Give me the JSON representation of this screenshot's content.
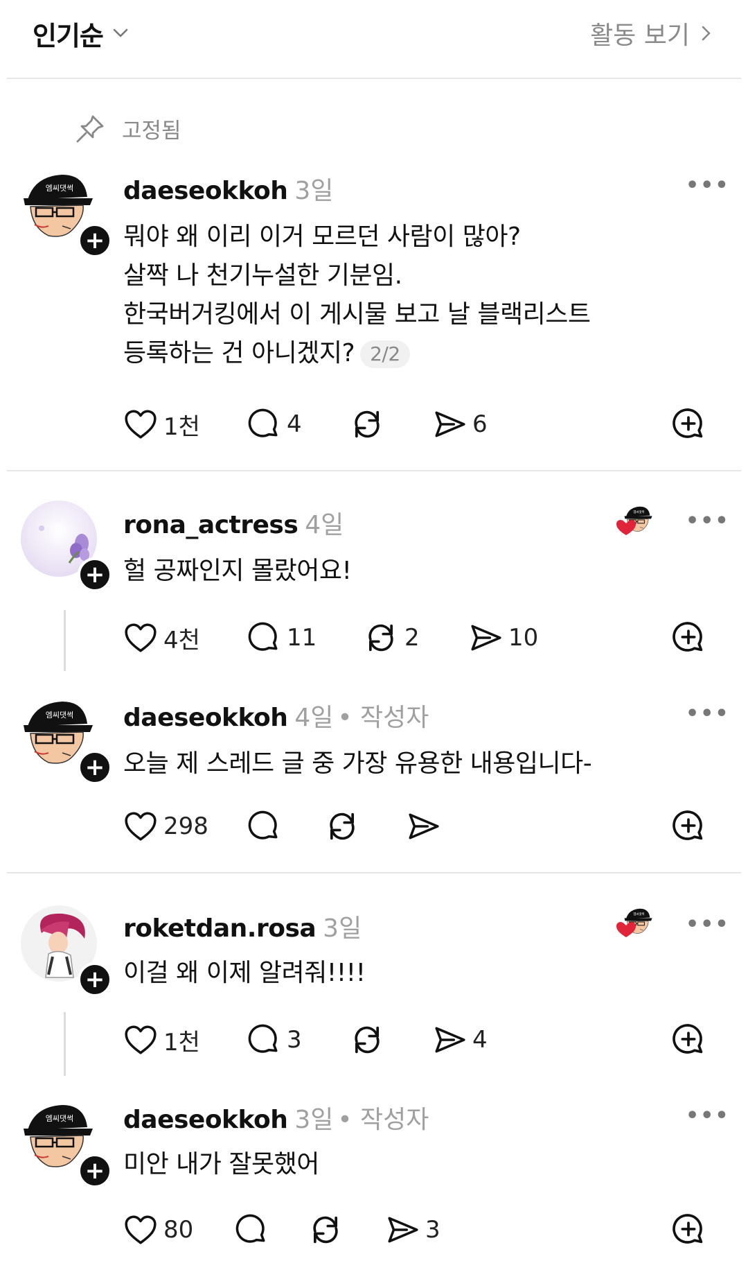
{
  "header": {
    "sort_label": "인기순",
    "activity_label": "활동 보기"
  },
  "pinned_label": "고정됨",
  "author_tag": "• 작성자",
  "comments": [
    {
      "username": "daeseokkoh",
      "time": "3일",
      "lines": [
        "뭐야 왜 이리 이거 모르던 사람이 많아?",
        "살짝 나 천기누설한 기분임.",
        "한국버거킹에서 이 게시물 보고 날 블랙리스트",
        "등록하는 건 아니겠지?"
      ],
      "page_indicator": "2/2",
      "likes": "1천",
      "replies": "4",
      "reposts": "",
      "shares": "6"
    },
    {
      "username": "rona_actress",
      "time": "4일",
      "lines": [
        "헐 공짜인지 몰랐어요!"
      ],
      "likes": "4천",
      "replies": "11",
      "reposts": "2",
      "shares": "10"
    },
    {
      "username": "daeseokkoh",
      "time": "4일",
      "lines": [
        "오늘 제 스레드 글 중 가장 유용한 내용입니다-"
      ],
      "likes": "298",
      "replies": "",
      "reposts": "",
      "shares": ""
    },
    {
      "username": "roketdan.rosa",
      "time": "3일",
      "lines": [
        "이걸 왜 이제 알려줘!!!!"
      ],
      "likes": "1천",
      "replies": "3",
      "reposts": "",
      "shares": "4"
    },
    {
      "username": "daeseokkoh",
      "time": "3일",
      "lines": [
        "미안 내가 잘못했어"
      ],
      "likes": "80",
      "replies": "",
      "reposts": "",
      "shares": "3"
    }
  ],
  "icons": [
    "chevron-down-icon",
    "chevron-right-icon",
    "pin-icon",
    "heart-icon",
    "comment-icon",
    "repost-icon",
    "share-icon",
    "add-icon",
    "more-icon",
    "liked-by-author-icon"
  ],
  "colors": {
    "text": "#111111",
    "muted": "#8a8a8a",
    "divider": "#e6e6e6",
    "heart": "#e0243a"
  }
}
